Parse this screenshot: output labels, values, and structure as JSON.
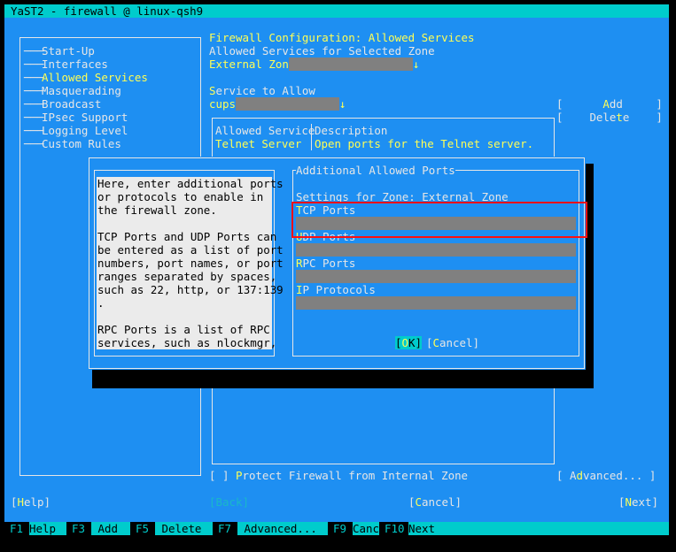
{
  "window": {
    "title": "YaST2 - firewall @ linux-qsh9"
  },
  "sidebar": {
    "items": [
      {
        "label": "Start-Up",
        "active": false
      },
      {
        "label": "Interfaces",
        "active": false
      },
      {
        "label": "Allowed Services",
        "active": true
      },
      {
        "label": "Masquerading",
        "active": false
      },
      {
        "label": "Broadcast",
        "active": false
      },
      {
        "label": "IPsec Support",
        "active": false
      },
      {
        "label": "Logging Level",
        "active": false
      },
      {
        "label": "Custom Rules",
        "active": false
      }
    ]
  },
  "main": {
    "heading": "Firewall Configuration: Allowed Services",
    "zone_label": "Allowed Services for Selected Zone",
    "zone_value": "External Zone",
    "service_label": "Service to Allow",
    "service_value": "cups",
    "add_button": "[      Add     ]",
    "delete_button": "[    Delete    ]",
    "table": {
      "headers": [
        "Allowed Service",
        "Description"
      ],
      "rows": [
        [
          "Telnet Server",
          "Open ports for the Telnet server."
        ]
      ]
    },
    "protect_checkbox": "[ ] Protect Firewall from Internal Zone",
    "advanced_button": "[ Advanced... ]"
  },
  "dialog": {
    "help_lines": [
      "Here, enter additional ports",
      "or protocols to enable in",
      "the firewall zone.",
      "",
      "TCP Ports and UDP Ports can",
      "be entered as a list of port",
      "numbers, port names, or port",
      "ranges separated by spaces,",
      "such as 22, http, or 137:139",
      ".",
      "",
      "RPC Ports is a list of RPC",
      "services, such as nlockmgr,"
    ],
    "frame_title": "Additional Allowed Ports",
    "zone_settings": "Settings for Zone: External Zone",
    "fields": [
      {
        "label": "TCP Ports",
        "value": ""
      },
      {
        "label": "UDP Ports",
        "value": ""
      },
      {
        "label": "RPC Ports",
        "value": ""
      },
      {
        "label": "IP Protocols",
        "value": ""
      }
    ],
    "ok_button": "[OK]",
    "cancel_button": "[Cancel]"
  },
  "buttons": {
    "help": "[Help]",
    "back": "[Back]",
    "cancel": "[Cancel]",
    "next": "[Next]"
  },
  "fkeys": [
    {
      "key": "F1",
      "label": "Help"
    },
    {
      "key": "F3",
      "label": " Add"
    },
    {
      "key": "F5",
      "label": " Delete"
    },
    {
      "key": "F7",
      "label": " Advanced..."
    },
    {
      "key": "F9",
      "label": "Cancel"
    },
    {
      "key": "F10",
      "label": "Next"
    }
  ],
  "colors": {
    "background": "#1e8ff2",
    "accent": "#00cccc",
    "highlight": "#ffff55",
    "field": "#808080",
    "selection_box": "#ff0000"
  }
}
